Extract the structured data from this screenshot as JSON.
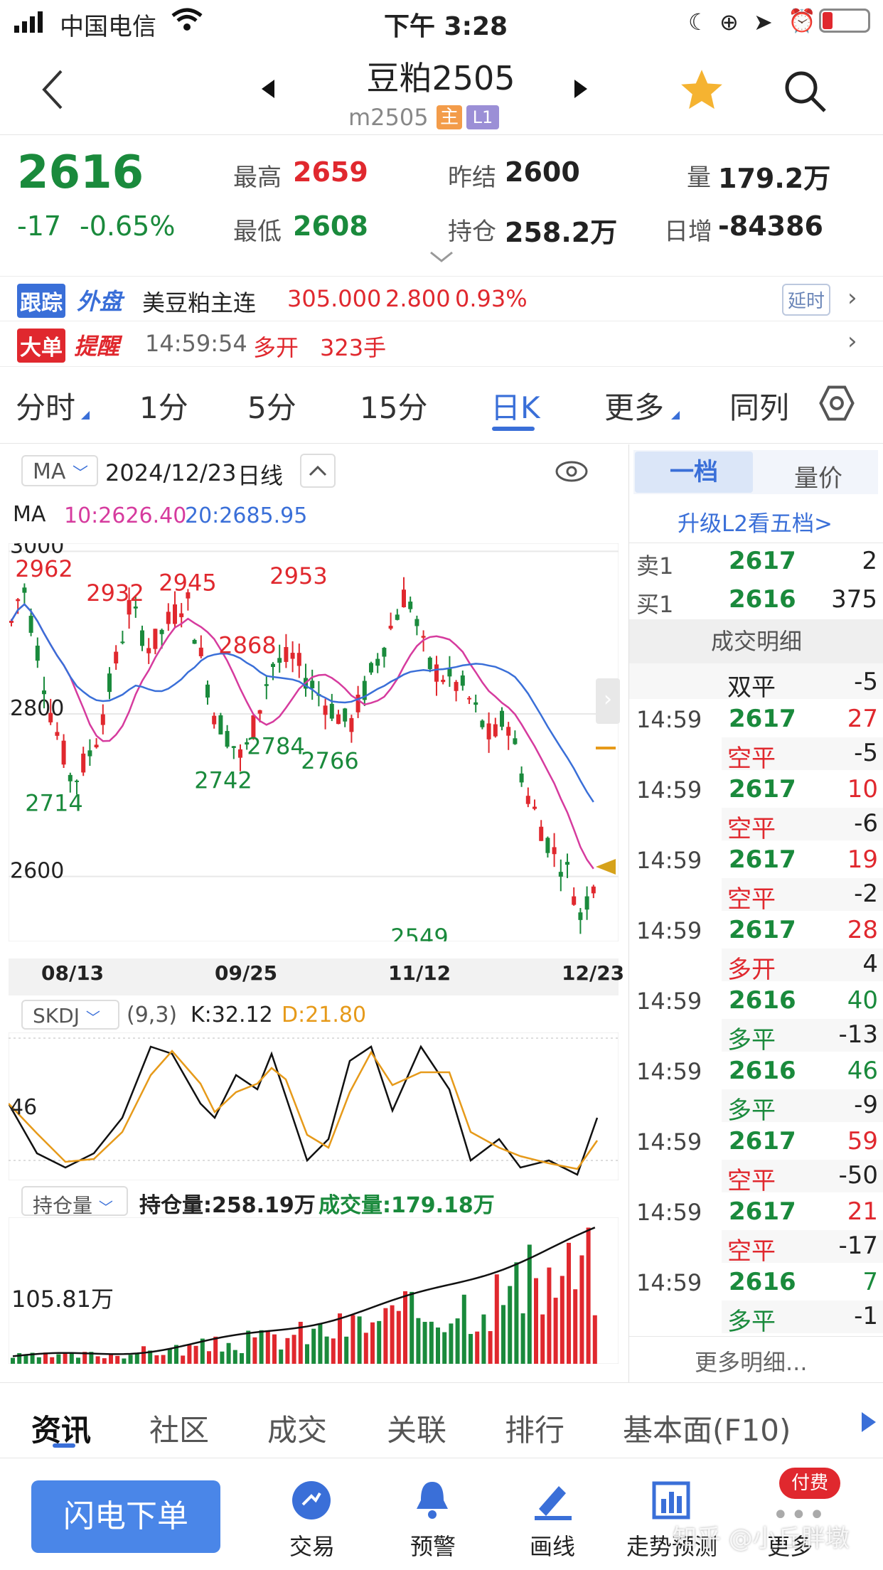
{
  "status": {
    "carrier": "中国电信",
    "time": "下午 3:28"
  },
  "header": {
    "title": "豆粕2505",
    "code": "m2505",
    "badge_main": "主",
    "badge_l1": "L1"
  },
  "quote": {
    "price": "2616",
    "change": "-17",
    "change_pct": "-0.65%",
    "high_label": "最高",
    "high": "2659",
    "low_label": "最低",
    "low": "2608",
    "prev_label": "昨结",
    "prev": "2600",
    "oi_label": "持仓",
    "oi": "258.2万",
    "vol_label": "量",
    "vol": "179.2万",
    "daily_inc_label": "日增",
    "daily_inc": "-84386"
  },
  "track": {
    "badge1": "跟踪",
    "badge2": "外盘",
    "name": "美豆粕主连",
    "price": "305.000",
    "chg": "2.800",
    "pct": "0.93%",
    "delay": "延时"
  },
  "alert": {
    "badge1": "大单",
    "badge2": "提醒",
    "time": "14:59:54",
    "action": "多开",
    "qty": "323手"
  },
  "ktabs": [
    "分时",
    "1分",
    "5分",
    "15分",
    "日K",
    "更多",
    "同列"
  ],
  "chart_bar": {
    "ma_select": "MA",
    "date": "2024/12/23",
    "period": "日线"
  },
  "ma_legend": {
    "label": "MA",
    "ma10": "10:2626.40",
    "ma20": "20:2685.95"
  },
  "chart_data": {
    "type": "candlestick",
    "y_ticks": [
      "3000",
      "2800",
      "2600"
    ],
    "x_ticks": [
      "08/13",
      "09/25",
      "11/12",
      "12/23"
    ],
    "annotations": [
      "2962",
      "2932",
      "2945",
      "2953",
      "2868",
      "2714",
      "2742",
      "2784",
      "2766",
      "2549"
    ],
    "ylim": [
      2520,
      3010
    ]
  },
  "kdj": {
    "select": "SKDJ",
    "params": "(9,3)",
    "k": "K:32.12",
    "d": "D:21.80",
    "tick": "46"
  },
  "oi_panel": {
    "select": "持仓量",
    "oi": "持仓量:258.19万",
    "vol": "成交量:179.18万",
    "tick": "105.81万"
  },
  "book": {
    "tab1": "一档",
    "tab2": "量价",
    "upgrade": "升级L2看五档>",
    "sell_label": "卖1",
    "sell_price": "2617",
    "sell_qty": "2",
    "buy_label": "买1",
    "buy_price": "2616",
    "buy_qty": "375",
    "detail_title": "成交明细",
    "first_type": "双平",
    "first_cnt": "-5",
    "trades": [
      {
        "time": "14:59",
        "price": "2617",
        "vol": "27",
        "type": "空平",
        "cnt": "-5"
      },
      {
        "time": "14:59",
        "price": "2617",
        "vol": "10",
        "type": "空平",
        "cnt": "-6"
      },
      {
        "time": "14:59",
        "price": "2617",
        "vol": "19",
        "type": "空平",
        "cnt": "-2"
      },
      {
        "time": "14:59",
        "price": "2617",
        "vol": "28",
        "type": "多开",
        "cnt": "4"
      },
      {
        "time": "14:59",
        "price": "2616",
        "vol": "40",
        "type": "多平",
        "cnt": "-13"
      },
      {
        "time": "14:59",
        "price": "2616",
        "vol": "46",
        "type": "多平",
        "cnt": "-9"
      },
      {
        "time": "14:59",
        "price": "2617",
        "vol": "59",
        "type": "空平",
        "cnt": "-50"
      },
      {
        "time": "14:59",
        "price": "2617",
        "vol": "21",
        "type": "空平",
        "cnt": "-17"
      },
      {
        "time": "14:59",
        "price": "2616",
        "vol": "7",
        "type": "多平",
        "cnt": "-1"
      }
    ],
    "more": "更多明细..."
  },
  "subtabs": [
    "资讯",
    "社区",
    "成交",
    "关联",
    "排行",
    "基本面(F10)"
  ],
  "bottom": {
    "flash": "闪电下单",
    "trade": "交易",
    "alert": "预警",
    "draw": "画线",
    "forecast": "走势预测",
    "more": "更多",
    "paid": "付费"
  },
  "watermark": "知乎 @小丘胖墩"
}
